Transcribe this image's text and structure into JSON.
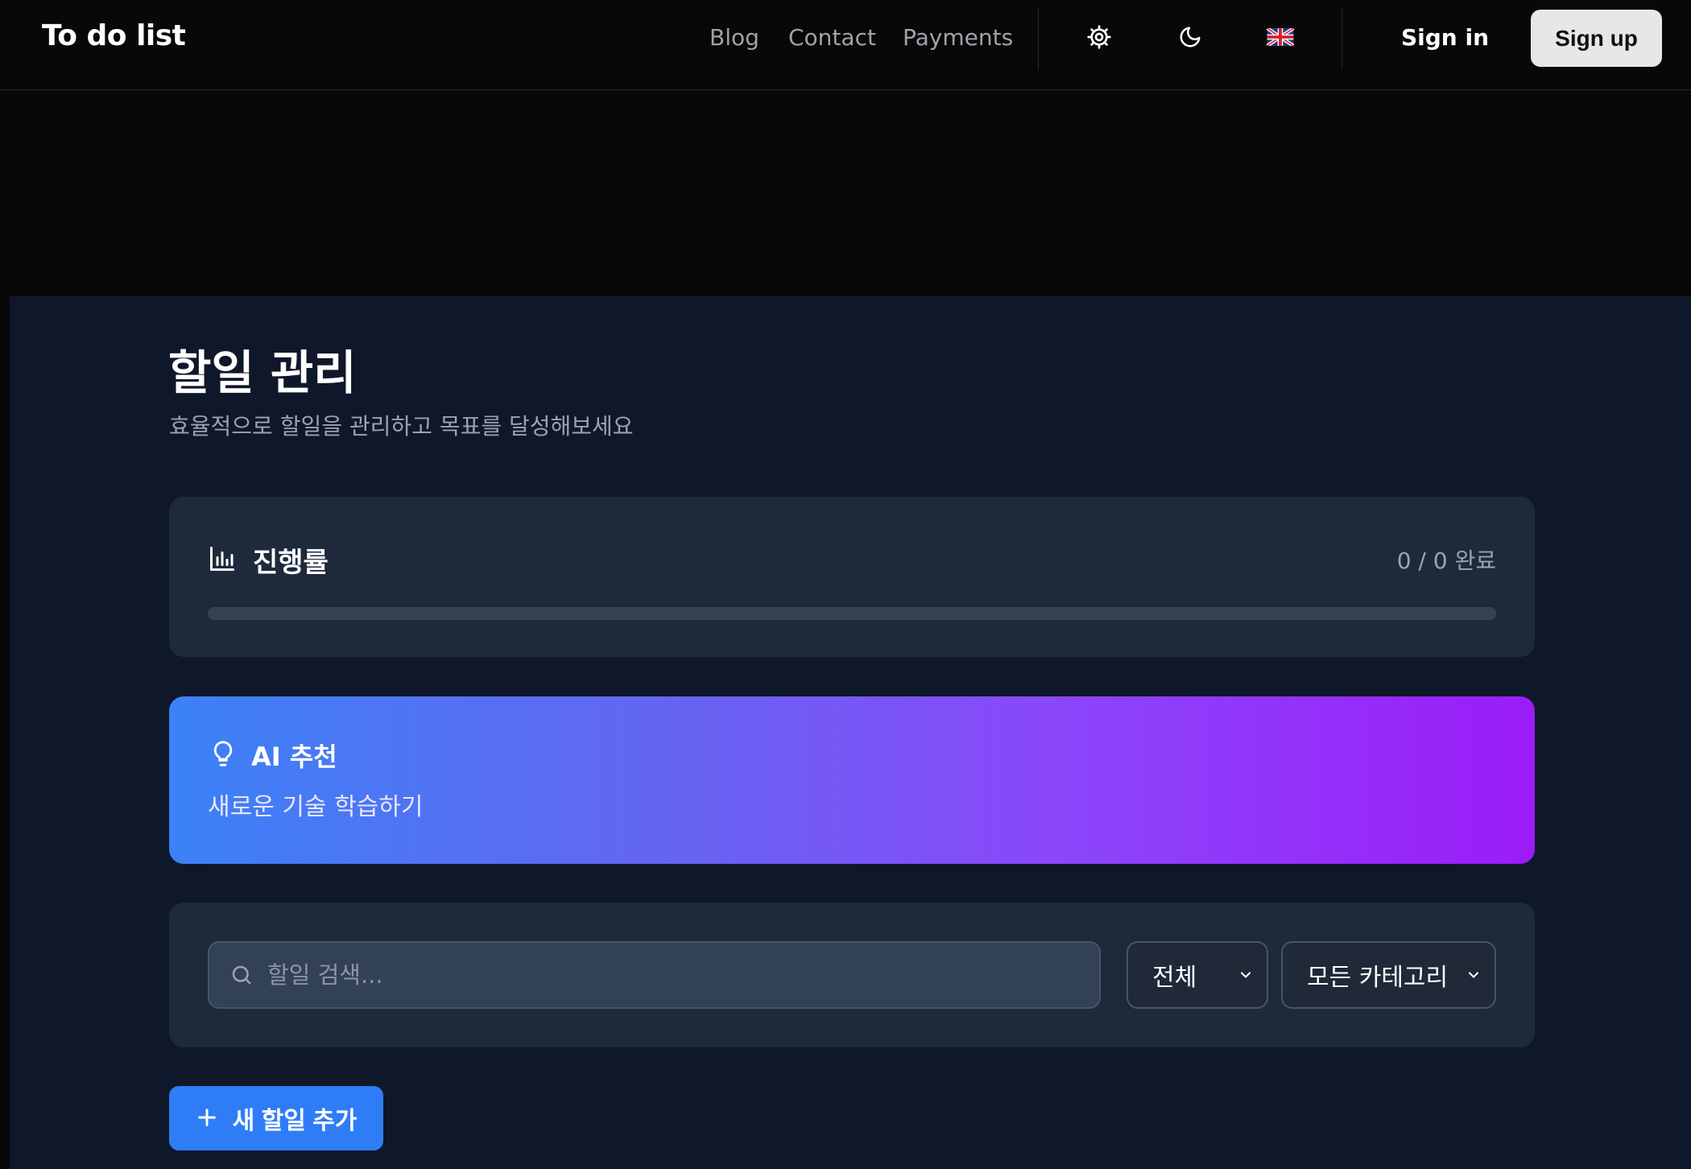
{
  "header": {
    "brand": "To do list",
    "nav": [
      {
        "label": "Blog"
      },
      {
        "label": "Contact"
      },
      {
        "label": "Payments"
      }
    ],
    "icons": [
      "settings-icon",
      "moon-icon",
      "uk-flag-icon"
    ],
    "sign_in": "Sign in",
    "sign_up": "Sign up"
  },
  "page": {
    "title": "할일 관리",
    "subtitle": "효율적으로 할일을 관리하고 목표를 달성해보세요"
  },
  "progress": {
    "title": "진행률",
    "count_text": "0 / 0 완료",
    "completed": 0,
    "total": 0,
    "icon": "bar-chart-icon"
  },
  "ai": {
    "title": "AI 추천",
    "suggestion": "새로운 기술 학습하기",
    "icon": "lightbulb-icon"
  },
  "filters": {
    "search_placeholder": "할일 검색...",
    "search_value": "",
    "status_selected": "전체",
    "category_selected": "모든 카테고리"
  },
  "actions": {
    "add_label": "새 할일 추가"
  },
  "colors": {
    "background": "#080808",
    "panel": "#0f172a",
    "card": "#1e293b",
    "accent": "#2f7df6",
    "gradient_start": "#3b82f6",
    "gradient_end": "#9b1cf8"
  }
}
